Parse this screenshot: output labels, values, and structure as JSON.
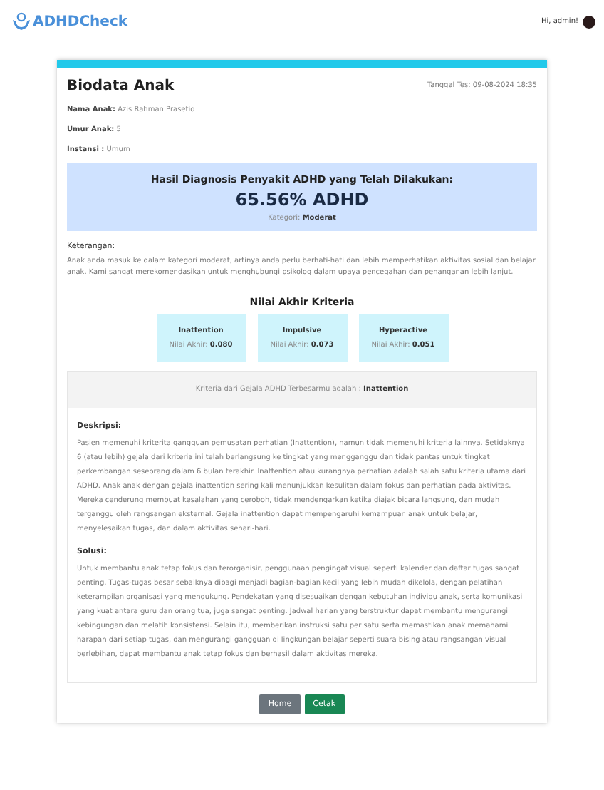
{
  "header": {
    "brand": "ADHDCheck",
    "greeting": "Hi, admin!"
  },
  "biodata": {
    "title": "Biodata Anak",
    "date": "Tanggal Tes: 09-08-2024 18:35",
    "fields": [
      {
        "label": "Nama Anak:",
        "value": "Azis Rahman Prasetio"
      },
      {
        "label": "Umur Anak:",
        "value": "5"
      },
      {
        "label": "Instansi :",
        "value": "Umum"
      }
    ]
  },
  "diagnosis": {
    "title": "Hasil Diagnosis Penyakit ADHD yang Telah Dilakukan:",
    "result": "65.56% ADHD",
    "category_label": "Kategori:",
    "category": "Moderat"
  },
  "keterangan": {
    "label": "Keterangan:",
    "text": "Anak anda masuk ke dalam kategori moderat, artinya anda perlu berhati-hati dan lebih memperhatikan aktivitas sosial dan belajar anak. Kami sangat merekomendasikan untuk menghubungi psikolog dalam upaya pencegahan dan penanganan lebih lanjut."
  },
  "criteria": {
    "title": "Nilai Akhir Kriteria",
    "items": [
      {
        "name": "Inattention",
        "label": "Nilai Akhir:",
        "value": "0.080"
      },
      {
        "name": "Impulsive",
        "label": "Nilai Akhir:",
        "value": "0.073"
      },
      {
        "name": "Hyperactive",
        "label": "Nilai Akhir:",
        "value": "0.051"
      }
    ]
  },
  "dominant": {
    "text": "Kriteria dari Gejala ADHD Terbesarmu adalah : **Inattention**"
  },
  "details": [
    {
      "label": "Deskripsi:",
      "text": "Pasien memenuhi kriterita gangguan pemusatan perhatian (Inattention), namun tidak memenuhi kriteria lainnya. Setidaknya 6 (atau lebih) gejala dari kriteria ini telah berlangsung ke tingkat yang mengganggu dan tidak pantas untuk tingkat perkembangan seseorang dalam 6 bulan terakhir. Inattention atau kurangnya perhatian adalah salah satu kriteria utama dari ADHD. Anak anak dengan gejala inattention sering kali menunjukkan kesulitan dalam fokus dan perhatian pada aktivitas. Mereka cenderung membuat kesalahan yang ceroboh, tidak mendengarkan ketika diajak bicara langsung, dan mudah terganggu oleh rangsangan eksternal. Gejala inattention dapat mempengaruhi kemampuan anak untuk belajar, menyelesaikan tugas, dan dalam aktivitas sehari-hari."
    },
    {
      "label": "Solusi:",
      "text": "Untuk membantu anak tetap fokus dan terorganisir, penggunaan pengingat visual seperti kalender dan daftar tugas sangat penting. Tugas-tugas besar sebaiknya dibagi menjadi bagian-bagian kecil yang lebih mudah dikelola, dengan pelatihan keterampilan organisasi yang mendukung. Pendekatan yang disesuaikan dengan kebutuhan individu anak, serta komunikasi yang kuat antara guru dan orang tua, juga sangat penting. Jadwal harian yang terstruktur dapat membantu mengurangi kebingungan dan melatih konsistensi. Selain itu, memberikan instruksi satu per satu serta memastikan anak memahami harapan dari setiap tugas, dan mengurangi gangguan di lingkungan belajar seperti suara bising atau rangsangan visual berlebihan, dapat membantu anak tetap fokus dan berhasil dalam aktivitas mereka."
    }
  ],
  "buttons": [
    {
      "label": "Home",
      "kind": "secondary"
    },
    {
      "label": "Cetak",
      "kind": "success"
    }
  ]
}
